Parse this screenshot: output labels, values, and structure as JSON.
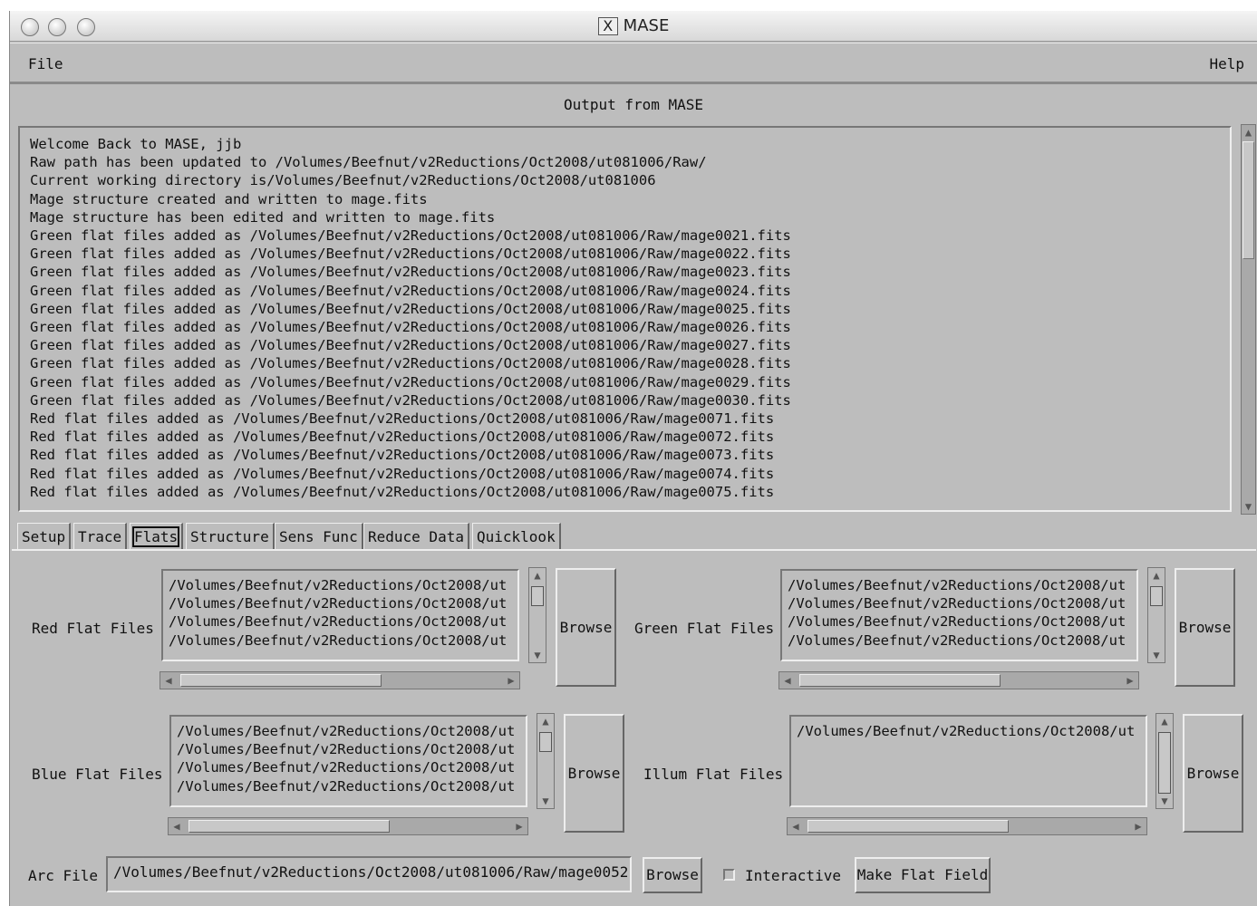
{
  "window": {
    "title": "MASE",
    "logo_text": "X"
  },
  "menu": {
    "left": "File",
    "right": "Help"
  },
  "output": {
    "label": "Output from MASE",
    "lines": [
      "Welcome Back to MASE, jjb",
      "Raw path has been updated to /Volumes/Beefnut/v2Reductions/Oct2008/ut081006/Raw/",
      "Current working directory is/Volumes/Beefnut/v2Reductions/Oct2008/ut081006",
      "Mage structure created and written to mage.fits",
      "Mage structure has been edited and written to mage.fits",
      "Green flat files added as /Volumes/Beefnut/v2Reductions/Oct2008/ut081006/Raw/mage0021.fits",
      "Green flat files added as /Volumes/Beefnut/v2Reductions/Oct2008/ut081006/Raw/mage0022.fits",
      "Green flat files added as /Volumes/Beefnut/v2Reductions/Oct2008/ut081006/Raw/mage0023.fits",
      "Green flat files added as /Volumes/Beefnut/v2Reductions/Oct2008/ut081006/Raw/mage0024.fits",
      "Green flat files added as /Volumes/Beefnut/v2Reductions/Oct2008/ut081006/Raw/mage0025.fits",
      "Green flat files added as /Volumes/Beefnut/v2Reductions/Oct2008/ut081006/Raw/mage0026.fits",
      "Green flat files added as /Volumes/Beefnut/v2Reductions/Oct2008/ut081006/Raw/mage0027.fits",
      "Green flat files added as /Volumes/Beefnut/v2Reductions/Oct2008/ut081006/Raw/mage0028.fits",
      "Green flat files added as /Volumes/Beefnut/v2Reductions/Oct2008/ut081006/Raw/mage0029.fits",
      "Green flat files added as /Volumes/Beefnut/v2Reductions/Oct2008/ut081006/Raw/mage0030.fits",
      "Red flat files added as /Volumes/Beefnut/v2Reductions/Oct2008/ut081006/Raw/mage0071.fits",
      "Red flat files added as /Volumes/Beefnut/v2Reductions/Oct2008/ut081006/Raw/mage0072.fits",
      "Red flat files added as /Volumes/Beefnut/v2Reductions/Oct2008/ut081006/Raw/mage0073.fits",
      "Red flat files added as /Volumes/Beefnut/v2Reductions/Oct2008/ut081006/Raw/mage0074.fits",
      "Red flat files added as /Volumes/Beefnut/v2Reductions/Oct2008/ut081006/Raw/mage0075.fits"
    ]
  },
  "tabs": [
    "Setup",
    "Trace",
    "Flats",
    "Structure",
    "Sens Func",
    "Reduce Data",
    "Quicklook"
  ],
  "active_tab": "Flats",
  "flats": {
    "red": {
      "label": "Red Flat Files",
      "files": [
        "/Volumes/Beefnut/v2Reductions/Oct2008/ut",
        "/Volumes/Beefnut/v2Reductions/Oct2008/ut",
        "/Volumes/Beefnut/v2Reductions/Oct2008/ut",
        "/Volumes/Beefnut/v2Reductions/Oct2008/ut"
      ],
      "browse": "Browse"
    },
    "green": {
      "label": "Green Flat Files",
      "files": [
        "/Volumes/Beefnut/v2Reductions/Oct2008/ut",
        "/Volumes/Beefnut/v2Reductions/Oct2008/ut",
        "/Volumes/Beefnut/v2Reductions/Oct2008/ut",
        "/Volumes/Beefnut/v2Reductions/Oct2008/ut"
      ],
      "browse": "Browse"
    },
    "blue": {
      "label": "Blue Flat Files",
      "files": [
        "/Volumes/Beefnut/v2Reductions/Oct2008/ut",
        "/Volumes/Beefnut/v2Reductions/Oct2008/ut",
        "/Volumes/Beefnut/v2Reductions/Oct2008/ut",
        "/Volumes/Beefnut/v2Reductions/Oct2008/ut"
      ],
      "browse": "Browse"
    },
    "illum": {
      "label": "Illum Flat Files",
      "files": [
        "/Volumes/Beefnut/v2Reductions/Oct2008/ut"
      ],
      "browse": "Browse"
    },
    "arc": {
      "label": "Arc File",
      "value": "/Volumes/Beefnut/v2Reductions/Oct2008/ut081006/Raw/mage0052.",
      "browse": "Browse"
    },
    "interactive": {
      "label": "Interactive",
      "checked": false
    },
    "make_flat_label": "Make Flat Field"
  },
  "icons": {
    "up": "arrow-up-icon",
    "down": "arrow-down-icon",
    "left": "arrow-left-icon",
    "right": "arrow-right-icon"
  }
}
